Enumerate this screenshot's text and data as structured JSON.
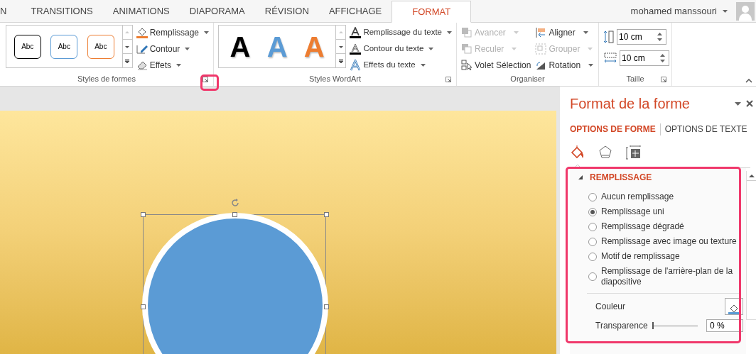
{
  "tabs": [
    {
      "label": "N",
      "selected": false
    },
    {
      "label": "TRANSITIONS",
      "selected": false
    },
    {
      "label": "ANIMATIONS",
      "selected": false
    },
    {
      "label": "DIAPORAMA",
      "selected": false
    },
    {
      "label": "RÉVISION",
      "selected": false
    },
    {
      "label": "AFFICHAGE",
      "selected": false
    },
    {
      "label": "FORMAT",
      "selected": true
    }
  ],
  "user": {
    "name": "mohamed manssouri"
  },
  "ribbon": {
    "groups": [
      {
        "kind": "shape_styles",
        "label": "Styles de formes",
        "launcher": true,
        "highlighted": true,
        "styles": [
          {
            "label": "Abc",
            "color": "#000000"
          },
          {
            "label": "Abc",
            "color": "#5b9bd5"
          },
          {
            "label": "Abc",
            "color": "#ed7d31"
          }
        ],
        "commands": [
          {
            "label": "Remplissage",
            "kind": "fill"
          },
          {
            "label": "Contour",
            "kind": "outline"
          },
          {
            "label": "Effets",
            "kind": "effects"
          }
        ]
      },
      {
        "kind": "wordart",
        "label": "Styles WordArt",
        "launcher": true,
        "highlighted": false,
        "styles": [
          {
            "label": "A",
            "color": "#000000"
          },
          {
            "label": "A",
            "color": "#5b9bd5"
          },
          {
            "label": "A",
            "color": "#ed7d31"
          }
        ],
        "commands": [
          {
            "label": "Remplissage du texte",
            "kind": "fill"
          },
          {
            "label": "Contour du texte",
            "kind": "outline"
          },
          {
            "label": "Effets du texte",
            "kind": "effects"
          }
        ]
      },
      {
        "kind": "arrange",
        "label": "Organiser",
        "launcher": false,
        "highlighted": false,
        "commands": [
          {
            "label": "Avancer",
            "kind": "forward",
            "disabled": true,
            "dropdown": true
          },
          {
            "label": "Reculer",
            "kind": "backward",
            "disabled": true,
            "dropdown": true
          },
          {
            "label": "Volet Sélection",
            "kind": "selection",
            "disabled": false,
            "dropdown": false
          },
          {
            "label": "Aligner",
            "kind": "align",
            "disabled": false,
            "dropdown": true
          },
          {
            "label": "Grouper",
            "kind": "group",
            "disabled": true,
            "dropdown": true
          },
          {
            "label": "Rotation",
            "kind": "rotate",
            "disabled": false,
            "dropdown": true
          }
        ]
      },
      {
        "kind": "size",
        "label": "Taille",
        "launcher": true,
        "highlighted": false,
        "fields": [
          {
            "kind": "height",
            "value": "10 cm"
          },
          {
            "kind": "width",
            "value": "10 cm"
          }
        ]
      }
    ]
  },
  "pane": {
    "title": "Format de la forme",
    "tabs": [
      {
        "label": "OPTIONS DE FORME",
        "selected": true
      },
      {
        "label": "OPTIONS DE TEXTE",
        "selected": false
      }
    ],
    "icons": [
      {
        "kind": "fill",
        "selected": true
      },
      {
        "kind": "effects",
        "selected": false
      },
      {
        "kind": "size",
        "selected": false
      }
    ],
    "section": {
      "title": "REMPLISSAGE",
      "expanded": true,
      "highlighted": true,
      "options": [
        {
          "label": "Aucun remplissage",
          "selected": false
        },
        {
          "label": "Remplissage uni",
          "selected": true
        },
        {
          "label": "Remplissage dégradé",
          "selected": false
        },
        {
          "label": "Remplissage avec image ou texture",
          "selected": false
        },
        {
          "label": "Motif de remplissage",
          "selected": false
        },
        {
          "label": "Remplissage de l'arrière-plan de la diapositive",
          "selected": false
        }
      ],
      "color_label": "Couleur",
      "transparency": {
        "label": "Transparence",
        "level": 0,
        "value": "0 %"
      }
    }
  }
}
